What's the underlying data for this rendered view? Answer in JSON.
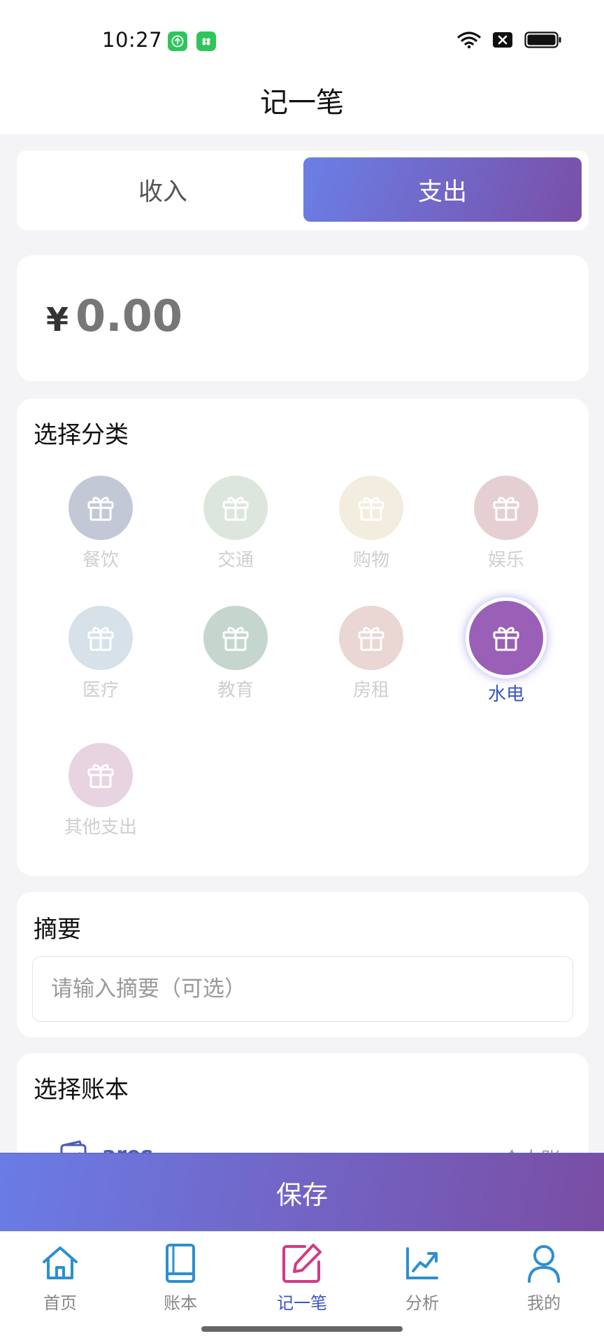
{
  "status_bar": {
    "time": "10:27"
  },
  "header": {
    "title": "记一笔"
  },
  "tabs": {
    "income_label": "收入",
    "expense_label": "支出",
    "active": "expense"
  },
  "amount": {
    "currency": "¥",
    "value": "0.00"
  },
  "category": {
    "title": "选择分类",
    "items": [
      {
        "label": "餐饮",
        "color": "#c3c8d6"
      },
      {
        "label": "交通",
        "color": "#dde6dd"
      },
      {
        "label": "购物",
        "color": "#f3ede0"
      },
      {
        "label": "娱乐",
        "color": "#e5cfd3"
      },
      {
        "label": "医疗",
        "color": "#d6e1e9"
      },
      {
        "label": "教育",
        "color": "#c4d6cd"
      },
      {
        "label": "房租",
        "color": "#ead6d3"
      },
      {
        "label": "水电",
        "color": "#9a5fb6",
        "selected": true
      },
      {
        "label": "其他支出",
        "color": "#e7d4e0"
      }
    ]
  },
  "summary": {
    "title": "摘要",
    "placeholder": "请输入摘要（可选）",
    "value": ""
  },
  "book": {
    "title": "选择账本",
    "name": "ares",
    "type": "个人账"
  },
  "save": {
    "label": "保存"
  },
  "nav": {
    "items": [
      {
        "label": "首页",
        "icon": "home-icon",
        "color": "#2d8fcf"
      },
      {
        "label": "账本",
        "icon": "book-icon",
        "color": "#2d8fcf"
      },
      {
        "label": "记一笔",
        "icon": "edit-icon",
        "color": "#d23a86",
        "active": true
      },
      {
        "label": "分析",
        "icon": "chart-icon",
        "color": "#2d8fcf"
      },
      {
        "label": "我的",
        "icon": "user-icon",
        "color": "#2d8fcf"
      }
    ]
  }
}
